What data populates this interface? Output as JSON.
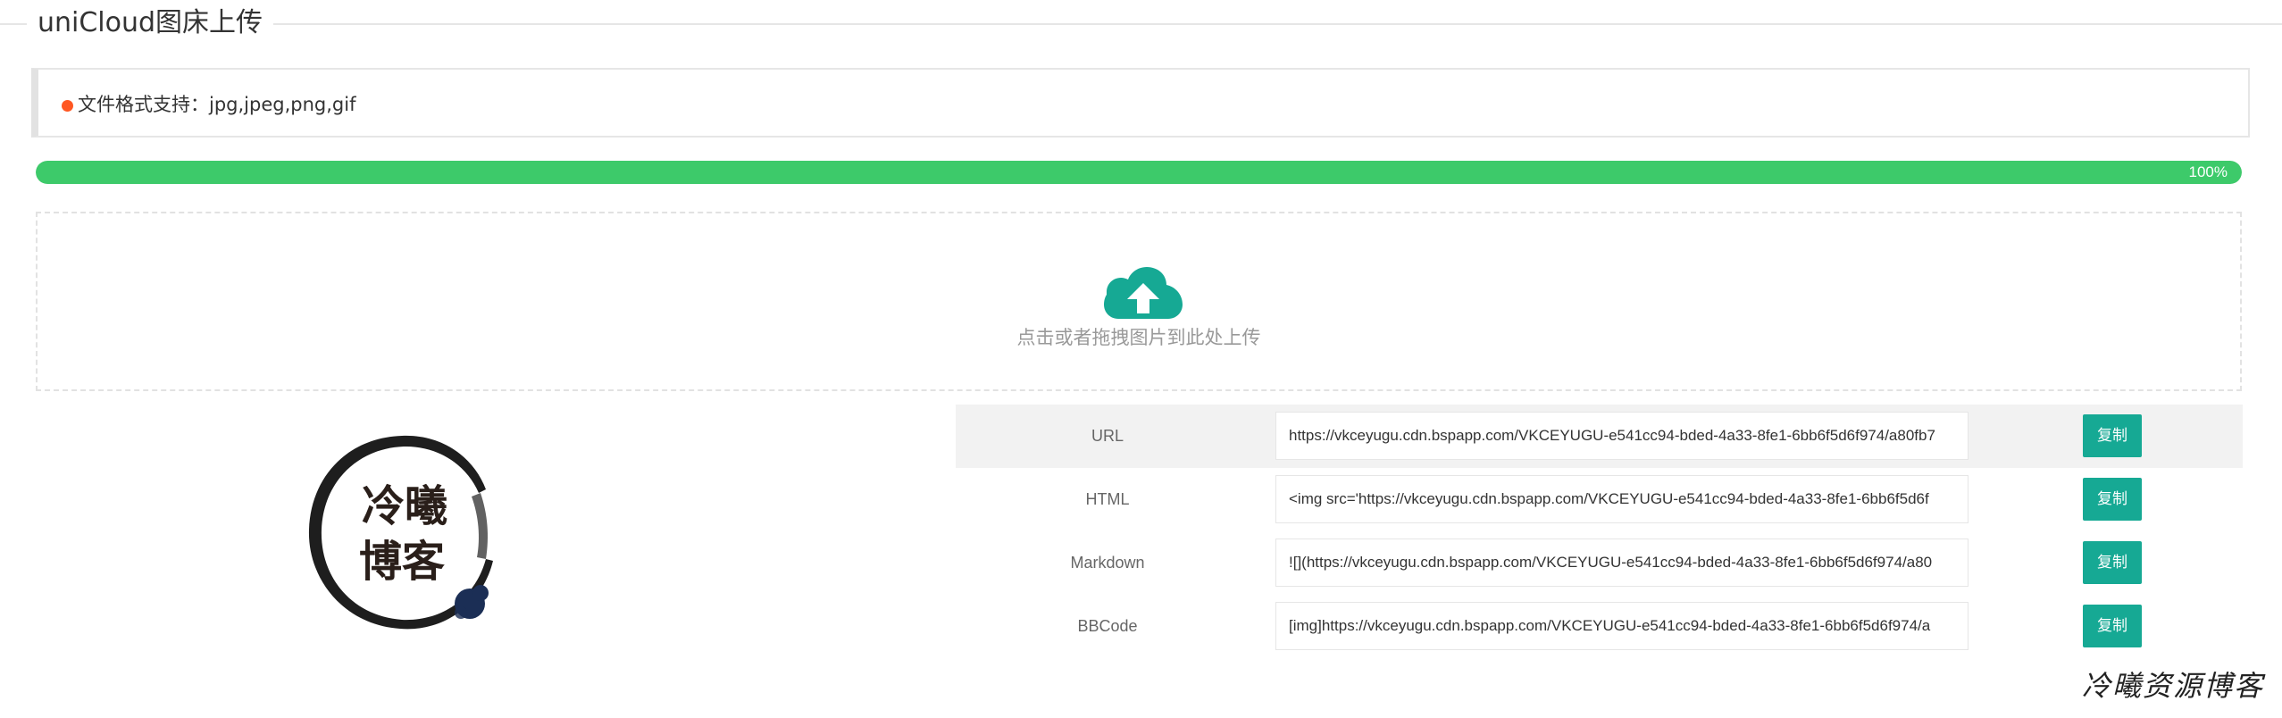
{
  "header": {
    "title": "uniCloud图床上传"
  },
  "notice": {
    "text": "文件格式支持：jpg,jpeg,png,gif",
    "dot_color": "#ff5722"
  },
  "progress": {
    "value": 1.0,
    "label": "100%",
    "color": "#3dca6a"
  },
  "upload": {
    "icon": "cloud-upload-icon",
    "hint": "点击或者拖拽图片到此处上传",
    "icon_color": "#16a994"
  },
  "logo": {
    "line1": "冷曦",
    "line2": "博客"
  },
  "links": [
    {
      "label": "URL",
      "value": "https://vkceyugu.cdn.bspapp.com/VKCEYUGU-e541cc94-bded-4a33-8fe1-6bb6f5d6f974/a80fb7",
      "button": "复制"
    },
    {
      "label": "HTML",
      "value": "<img src='https://vkceyugu.cdn.bspapp.com/VKCEYUGU-e541cc94-bded-4a33-8fe1-6bb6f5d6f",
      "button": "复制"
    },
    {
      "label": "Markdown",
      "value": "![](https://vkceyugu.cdn.bspapp.com/VKCEYUGU-e541cc94-bded-4a33-8fe1-6bb6f5d6f974/a80",
      "button": "复制"
    },
    {
      "label": "BBCode",
      "value": "[img]https://vkceyugu.cdn.bspapp.com/VKCEYUGU-e541cc94-bded-4a33-8fe1-6bb6f5d6f974/a",
      "button": "复制"
    }
  ],
  "watermark": "冷曦资源博客",
  "colors": {
    "accent": "#16a994",
    "border": "#e6e6e6"
  }
}
